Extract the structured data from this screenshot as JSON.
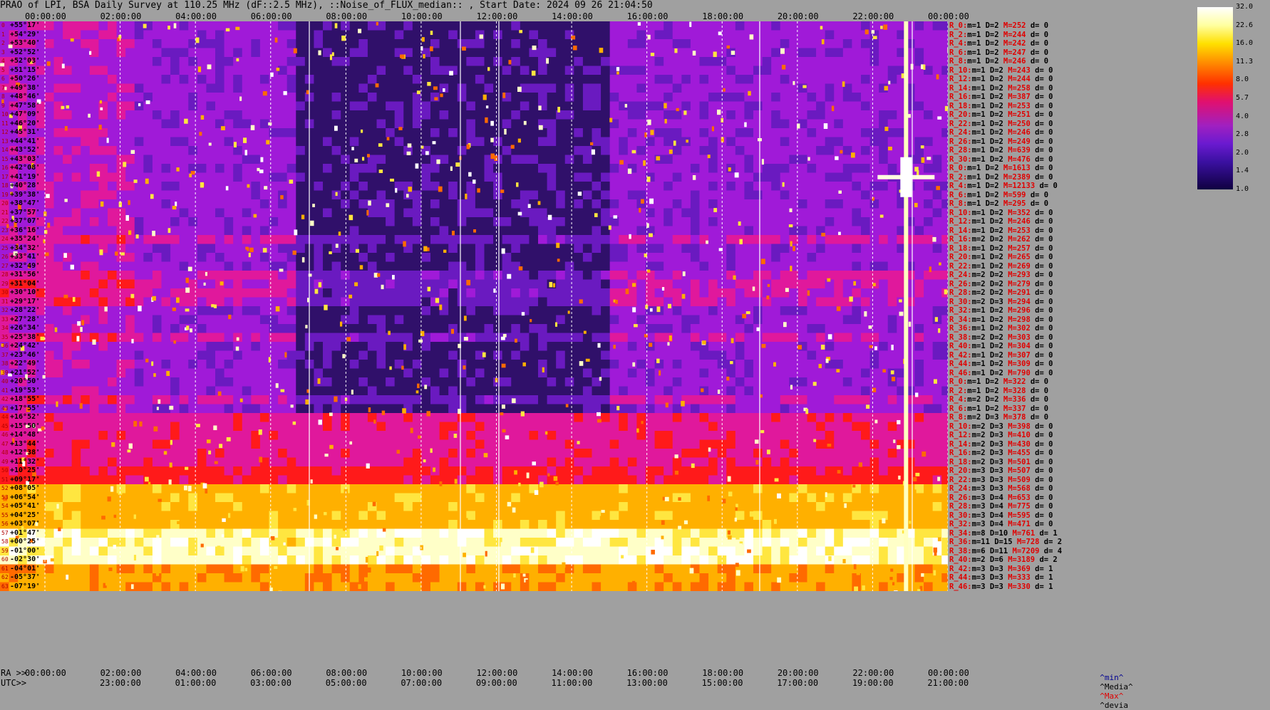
{
  "title": "PRAO of LPI, BSA Daily Survey at 110.25 MHz (dF::2.5 MHz), ::Noise_of_FLUX_median:: , Start Date: 2024 09 26 21:04:50",
  "axis": {
    "ra_prefix": "RA >>",
    "utc_prefix": "UTC>>",
    "ra_ticks": [
      "00:00:00",
      "02:00:00",
      "04:00:00",
      "06:00:00",
      "08:00:00",
      "10:00:00",
      "12:00:00",
      "14:00:00",
      "16:00:00",
      "18:00:00",
      "20:00:00",
      "22:00:00",
      "00:00:00"
    ],
    "utc_ticks": [
      "23:00:00",
      "01:00:00",
      "03:00:00",
      "05:00:00",
      "07:00:00",
      "09:00:00",
      "11:00:00",
      "13:00:00",
      "15:00:00",
      "17:00:00",
      "19:00:00",
      "21:00:00"
    ]
  },
  "declinations": [
    "+55°17'",
    "+54°29'",
    "+53°40'",
    "+52°52'",
    "+52°03'",
    "+51°15'",
    "+50°26'",
    "+49°38'",
    "+48°46'",
    "+47°58'",
    "+47°09'",
    "+46°20'",
    "+45°31'",
    "+44°41'",
    "+43°52'",
    "+43°03'",
    "+42°08'",
    "+41°19'",
    "+40°28'",
    "+39°38'",
    "+38°47'",
    "+37°57'",
    "+37°07'",
    "+36°16'",
    "+35°24'",
    "+34°32'",
    "+33°41'",
    "+32°49'",
    "+31°56'",
    "+31°04'",
    "+30°10'",
    "+29°17'",
    "+28°22'",
    "+27°28'",
    "+26°34'",
    "+25°38'",
    "+24°42'",
    "+23°46'",
    "+22°49'",
    "+21°52'",
    "+20°50'",
    "+19°53'",
    "+18°55'",
    "+17°55'",
    "+16°52'",
    "+15°50'",
    "+14°48'",
    "+13°44'",
    "+12°38'",
    "+11°32'",
    "+10°25'",
    "+09°17'",
    "+08°05'",
    "+06°54'",
    "+05°41'",
    "+04°25'",
    "+03°07'",
    "+01°47'",
    "+00°25'",
    "-01°00'",
    "-02°30'",
    "-04°01'",
    "-05°37'",
    "-07°19'"
  ],
  "stats": [
    {
      "r": "R_0:",
      "m": "1",
      "d": "2",
      "M": "252",
      "dev": "0"
    },
    {
      "r": "R_2:",
      "m": "1",
      "d": "2",
      "M": "244",
      "dev": "0"
    },
    {
      "r": "R_4:",
      "m": "1",
      "d": "2",
      "M": "242",
      "dev": "0"
    },
    {
      "r": "R_6:",
      "m": "1",
      "d": "2",
      "M": "247",
      "dev": "0"
    },
    {
      "r": "R_8:",
      "m": "1",
      "d": "2",
      "M": "246",
      "dev": "0"
    },
    {
      "r": "R_10:",
      "m": "1",
      "d": "2",
      "M": "243",
      "dev": "0"
    },
    {
      "r": "R_12:",
      "m": "1",
      "d": "2",
      "M": "244",
      "dev": "0"
    },
    {
      "r": "R_14:",
      "m": "1",
      "d": "2",
      "M": "258",
      "dev": "0"
    },
    {
      "r": "R_16:",
      "m": "1",
      "d": "2",
      "M": "387",
      "dev": "0"
    },
    {
      "r": "R_18:",
      "m": "1",
      "d": "2",
      "M": "253",
      "dev": "0"
    },
    {
      "r": "R_20:",
      "m": "1",
      "d": "2",
      "M": "251",
      "dev": "0"
    },
    {
      "r": "R_22:",
      "m": "1",
      "d": "2",
      "M": "250",
      "dev": "0"
    },
    {
      "r": "R_24:",
      "m": "1",
      "d": "2",
      "M": "246",
      "dev": "0"
    },
    {
      "r": "R_26:",
      "m": "1",
      "d": "2",
      "M": "249",
      "dev": "0"
    },
    {
      "r": "R_28:",
      "m": "1",
      "d": "2",
      "M": "639",
      "dev": "0"
    },
    {
      "r": "R_30:",
      "m": "1",
      "d": "2",
      "M": "476",
      "dev": "0"
    },
    {
      "r": "R_0:",
      "m": "1",
      "d": "2",
      "M": "1613",
      "dev": "0"
    },
    {
      "r": "R_2:",
      "m": "1",
      "d": "2",
      "M": "2389",
      "dev": "0"
    },
    {
      "r": "R_4:",
      "m": "1",
      "d": "2",
      "M": "12133",
      "dev": "0"
    },
    {
      "r": "R_6:",
      "m": "1",
      "d": "2",
      "M": "599",
      "dev": "0"
    },
    {
      "r": "R_8:",
      "m": "1",
      "d": "2",
      "M": "295",
      "dev": "0"
    },
    {
      "r": "R_10:",
      "m": "1",
      "d": "2",
      "M": "352",
      "dev": "0"
    },
    {
      "r": "R_12:",
      "m": "1",
      "d": "2",
      "M": "246",
      "dev": "0"
    },
    {
      "r": "R_14:",
      "m": "1",
      "d": "2",
      "M": "253",
      "dev": "0"
    },
    {
      "r": "R_16:",
      "m": "2",
      "d": "2",
      "M": "262",
      "dev": "0"
    },
    {
      "r": "R_18:",
      "m": "1",
      "d": "2",
      "M": "257",
      "dev": "0"
    },
    {
      "r": "R_20:",
      "m": "1",
      "d": "2",
      "M": "265",
      "dev": "0"
    },
    {
      "r": "R_22:",
      "m": "1",
      "d": "2",
      "M": "269",
      "dev": "0"
    },
    {
      "r": "R_24:",
      "m": "2",
      "d": "2",
      "M": "293",
      "dev": "0"
    },
    {
      "r": "R_26:",
      "m": "2",
      "d": "2",
      "M": "279",
      "dev": "0"
    },
    {
      "r": "R_28:",
      "m": "2",
      "d": "2",
      "M": "291",
      "dev": "0"
    },
    {
      "r": "R_30:",
      "m": "2",
      "d": "3",
      "M": "294",
      "dev": "0"
    },
    {
      "r": "R_32:",
      "m": "1",
      "d": "2",
      "M": "296",
      "dev": "0"
    },
    {
      "r": "R_34:",
      "m": "1",
      "d": "2",
      "M": "298",
      "dev": "0"
    },
    {
      "r": "R_36:",
      "m": "1",
      "d": "2",
      "M": "302",
      "dev": "0"
    },
    {
      "r": "R_38:",
      "m": "2",
      "d": "2",
      "M": "303",
      "dev": "0"
    },
    {
      "r": "R_40:",
      "m": "1",
      "d": "2",
      "M": "304",
      "dev": "0"
    },
    {
      "r": "R_42:",
      "m": "1",
      "d": "2",
      "M": "307",
      "dev": "0"
    },
    {
      "r": "R_44:",
      "m": "1",
      "d": "2",
      "M": "309",
      "dev": "0"
    },
    {
      "r": "R_46:",
      "m": "1",
      "d": "2",
      "M": "790",
      "dev": "0"
    },
    {
      "r": "R_0:",
      "m": "1",
      "d": "2",
      "M": "322",
      "dev": "0"
    },
    {
      "r": "R_2:",
      "m": "1",
      "d": "2",
      "M": "328",
      "dev": "0"
    },
    {
      "r": "R_4:",
      "m": "2",
      "d": "2",
      "M": "336",
      "dev": "0"
    },
    {
      "r": "R_6:",
      "m": "1",
      "d": "2",
      "M": "337",
      "dev": "0"
    },
    {
      "r": "R_8:",
      "m": "2",
      "d": "3",
      "M": "378",
      "dev": "0"
    },
    {
      "r": "R_10:",
      "m": "2",
      "d": "3",
      "M": "398",
      "dev": "0"
    },
    {
      "r": "R_12:",
      "m": "2",
      "d": "3",
      "M": "410",
      "dev": "0"
    },
    {
      "r": "R_14:",
      "m": "2",
      "d": "3",
      "M": "430",
      "dev": "0"
    },
    {
      "r": "R_16:",
      "m": "2",
      "d": "3",
      "M": "455",
      "dev": "0"
    },
    {
      "r": "R_18:",
      "m": "2",
      "d": "3",
      "M": "501",
      "dev": "0"
    },
    {
      "r": "R_20:",
      "m": "3",
      "d": "3",
      "M": "507",
      "dev": "0"
    },
    {
      "r": "R_22:",
      "m": "3",
      "d": "3",
      "M": "509",
      "dev": "0"
    },
    {
      "r": "R_24:",
      "m": "3",
      "d": "3",
      "M": "568",
      "dev": "0"
    },
    {
      "r": "R_26:",
      "m": "3",
      "d": "4",
      "M": "653",
      "dev": "0"
    },
    {
      "r": "R_28:",
      "m": "3",
      "d": "4",
      "M": "775",
      "dev": "0"
    },
    {
      "r": "R_30:",
      "m": "3",
      "d": "4",
      "M": "595",
      "dev": "0"
    },
    {
      "r": "R_32:",
      "m": "3",
      "d": "4",
      "M": "471",
      "dev": "0"
    },
    {
      "r": "R_34:",
      "m": "8",
      "d": "10",
      "M": "761",
      "dev": "1"
    },
    {
      "r": "R_36:",
      "m": "11",
      "d": "15",
      "M": "728",
      "dev": "2"
    },
    {
      "r": "R_38:",
      "m": "6",
      "d": "11",
      "M": "7209",
      "dev": "4"
    },
    {
      "r": "R_40:",
      "m": "2",
      "d": "6",
      "M": "3189",
      "dev": "2"
    },
    {
      "r": "R_42:",
      "m": "3",
      "d": "3",
      "M": "369",
      "dev": "1"
    },
    {
      "r": "R_44:",
      "m": "3",
      "d": "3",
      "M": "333",
      "dev": "1"
    },
    {
      "r": "R_46:",
      "m": "3",
      "d": "3",
      "M": "330",
      "dev": "1"
    }
  ],
  "legend_foot": {
    "min": "^min^",
    "media": "^Media^",
    "max": "^Max^",
    "devia": "^devia"
  },
  "colorbar": {
    "ticks": [
      "32.0",
      "22.6",
      "16.0",
      "11.3",
      "8.0",
      "5.7",
      "4.0",
      "2.8",
      "2.0",
      "1.4",
      "1.0"
    ]
  },
  "chart_data": {
    "type": "heatmap",
    "title": "PRAO of LPI, BSA Daily Survey at 110.25 MHz (dF::2.5 MHz), ::Noise_of_FLUX_median:: , Start Date: 2024 09 26 21:04:50",
    "x_ra_ticks": [
      "00:00:00",
      "02:00:00",
      "04:00:00",
      "06:00:00",
      "08:00:00",
      "10:00:00",
      "12:00:00",
      "14:00:00",
      "16:00:00",
      "18:00:00",
      "20:00:00",
      "22:00:00",
      "00:00:00"
    ],
    "x_utc_ticks": [
      "23:00:00",
      "01:00:00",
      "03:00:00",
      "05:00:00",
      "07:00:00",
      "09:00:00",
      "11:00:00",
      "13:00:00",
      "15:00:00",
      "17:00:00",
      "19:00:00",
      "21:00:00"
    ],
    "color_scale": {
      "min": 1.0,
      "max": 32.0,
      "scale": "log2"
    },
    "rows": 64,
    "colormap": [
      "#000018",
      "#30106a",
      "#6a1ac0",
      "#a01ad8",
      "#e0189c",
      "#ff1a1a",
      "#ff6a00",
      "#ffb000",
      "#ffe640",
      "#ffffc8",
      "#ffffff"
    ],
    "features": [
      {
        "desc": "strong source streak",
        "ra_hours": 20.0,
        "dec_rows": [
          0,
          63
        ],
        "level": 32
      },
      {
        "desc": "bright blob",
        "ra_hours": 20.0,
        "dec_row": 17,
        "level": 32
      }
    ]
  }
}
